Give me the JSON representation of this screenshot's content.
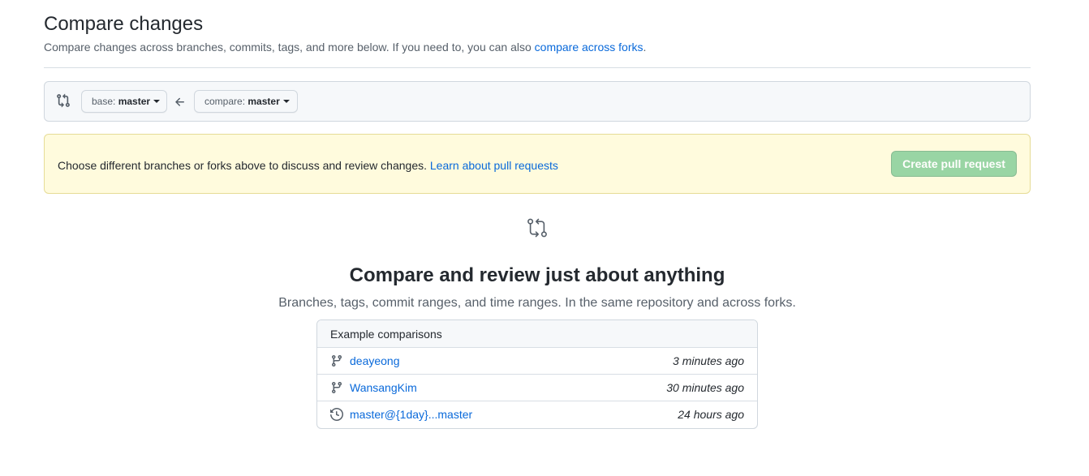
{
  "header": {
    "title": "Compare changes",
    "subtitle_prefix": "Compare changes across branches, commits, tags, and more below. If you need to, you can also ",
    "subtitle_link": "compare across forks",
    "subtitle_suffix": "."
  },
  "range": {
    "base_label": "base:",
    "base_value": "master",
    "compare_label": "compare:",
    "compare_value": "master"
  },
  "flash": {
    "text": "Choose different branches or forks above to discuss and review changes. ",
    "link": "Learn about pull requests",
    "create_button": "Create pull request"
  },
  "blankslate": {
    "title": "Compare and review just about anything",
    "description": "Branches, tags, commit ranges, and time ranges. In the same repository and across forks."
  },
  "examples": {
    "header": "Example comparisons",
    "rows": [
      {
        "icon": "branch-icon",
        "label": "deayeong",
        "time": "3 minutes ago"
      },
      {
        "icon": "branch-icon",
        "label": "WansangKim",
        "time": "30 minutes ago"
      },
      {
        "icon": "history-icon",
        "label": "master@{1day}...master",
        "time": "24 hours ago"
      }
    ]
  },
  "colors": {
    "link": "#0969da",
    "flash_bg": "#fffbdd",
    "create_button_bg": "#94d3a2"
  }
}
